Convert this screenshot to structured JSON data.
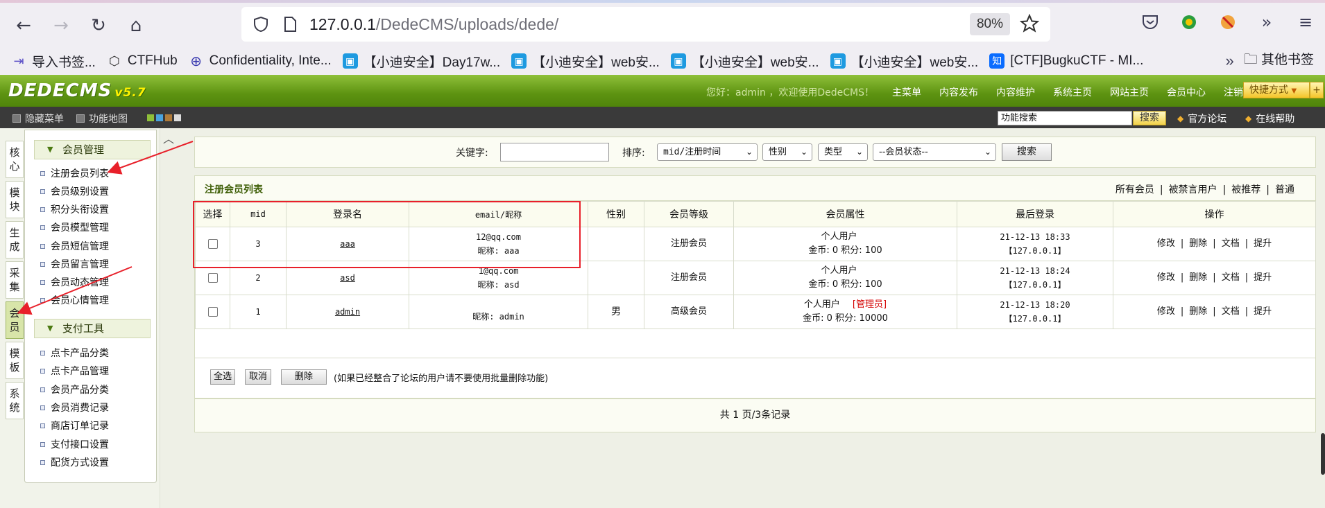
{
  "browser": {
    "url_host": "127.0.0.1",
    "url_path": "/DedeCMS/uploads/dede/",
    "zoom": "80%",
    "bookmarks": [
      {
        "label": "导入书签...",
        "color": "#5b4fc7"
      },
      {
        "label": "CTFHub",
        "color": "#333333"
      },
      {
        "label": "Confidentiality, Inte...",
        "color": "#3b3bb0"
      },
      {
        "label": "【小迪安全】Day17w...",
        "color": "#1e9ae0"
      },
      {
        "label": "【小迪安全】web安...",
        "color": "#1e9ae0"
      },
      {
        "label": "【小迪安全】web安...",
        "color": "#1e9ae0"
      },
      {
        "label": "【小迪安全】web安...",
        "color": "#1e9ae0"
      },
      {
        "label": "[CTF]BugkuCTF - MI...",
        "color": "#0a6cff"
      }
    ],
    "other_bookmarks": "其他书签"
  },
  "header": {
    "logo": "DEDECMS",
    "version": "v5.7",
    "welcome": "您好：admin ，欢迎使用DedeCMS！",
    "links": [
      "主菜单",
      "内容发布",
      "内容维护",
      "系统主页",
      "网站主页",
      "会员中心",
      "注销"
    ],
    "quick": "快捷方式",
    "quick_plus": "+"
  },
  "subbar": {
    "hide_menu": "隐藏菜单",
    "feature_map": "功能地图",
    "search_value": "功能搜索",
    "search_btn": "搜索",
    "forum": "官方论坛",
    "help": "在线帮助",
    "swatches": [
      "#8fc03a",
      "#4aa3df",
      "#b07b3a",
      "#dddddd"
    ]
  },
  "vtabs": [
    "核心",
    "模块",
    "生成",
    "采集",
    "会员",
    "模板",
    "系统"
  ],
  "sidebar": {
    "group1": "会员管理",
    "group1_items": [
      "注册会员列表",
      "会员级别设置",
      "积分头衔设置",
      "会员模型管理",
      "会员短信管理",
      "会员留言管理",
      "会员动态管理",
      "会员心情管理"
    ],
    "group2": "支付工具",
    "group2_items": [
      "点卡产品分类",
      "点卡产品管理",
      "会员产品分类",
      "会员消费记录",
      "商店订单记录",
      "支付接口设置",
      "配货方式设置"
    ]
  },
  "search": {
    "keyword_label": "关键字:",
    "sort_label": "排序:",
    "sort_value": "mid/注册时间",
    "gender_value": "性别",
    "type_value": "类型",
    "status_value": "--会员状态--",
    "search_btn": "搜索"
  },
  "list": {
    "title": "注册会员列表",
    "filters": [
      "所有会员",
      "被禁言用户",
      "被推荐",
      "普通"
    ],
    "columns": [
      "选择",
      "mid",
      "登录名",
      "email/昵称",
      "性别",
      "会员等级",
      "会员属性",
      "最后登录",
      "操作"
    ],
    "rows": [
      {
        "mid": "3",
        "login": "aaa",
        "email": "12@qq.com",
        "nick": "昵称: aaa",
        "gender": "",
        "level": "注册会员",
        "attr1": "个人用户",
        "attr_tag": "",
        "attr2": "金币: 0 积分: 100",
        "last_time": "21-12-13 18:33",
        "last_ip": "【127.0.0.1】"
      },
      {
        "mid": "2",
        "login": "asd",
        "email": "1@qq.com",
        "nick": "昵称: asd",
        "gender": "",
        "level": "注册会员",
        "attr1": "个人用户",
        "attr_tag": "",
        "attr2": "金币: 0 积分: 100",
        "last_time": "21-12-13 18:24",
        "last_ip": "【127.0.0.1】"
      },
      {
        "mid": "1",
        "login": "admin",
        "email": "",
        "nick": "昵称: admin",
        "gender": "男",
        "level": "高级会员",
        "attr1": "个人用户",
        "attr_tag": "[管理员]",
        "attr2": "金币: 0 积分: 10000",
        "last_time": "21-12-13 18:20",
        "last_ip": "【127.0.0.1】"
      }
    ],
    "ops": [
      "修改",
      "删除",
      "文档",
      "提升"
    ],
    "select_all": "全选",
    "cancel": "取消",
    "delete": "删除",
    "note": "(如果已经整合了论坛的用户请不要使用批量删除功能)",
    "pager": "共 1 页/3条记录"
  },
  "colors": {
    "accent_green": "#5d9311",
    "annotation_red": "#e8202a",
    "admin_red": "#d40000"
  }
}
